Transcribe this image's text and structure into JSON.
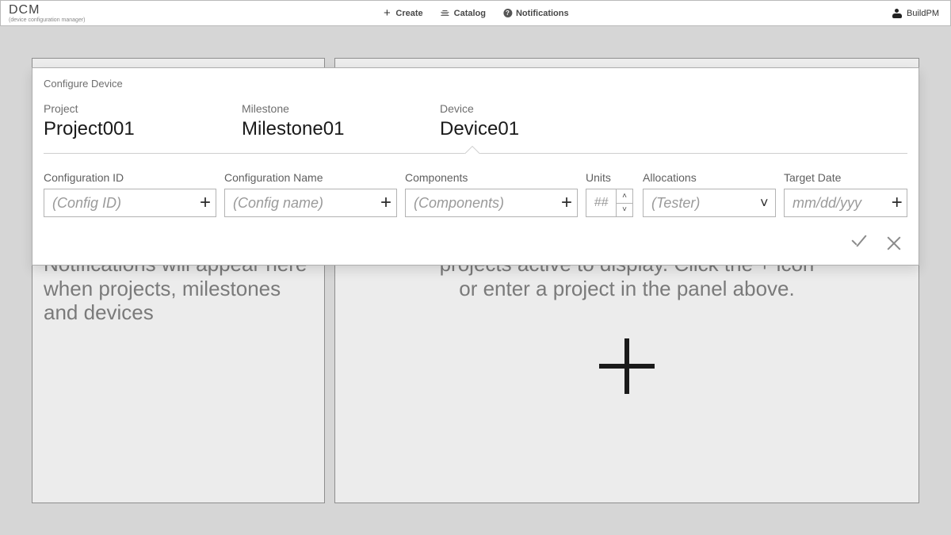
{
  "brand": {
    "title": "DCM",
    "subtitle": "(device configuration manager)"
  },
  "nav": {
    "create": "Create",
    "catalog": "Catalog",
    "notifications": "Notifications",
    "user": "BuildPM"
  },
  "panels": {
    "left_text": "Notifications will appear here when projects, milestones and devices",
    "right_text": "projects active to display. Click the + icon or enter a project in the panel above."
  },
  "modal": {
    "title": "Configure Device",
    "crumbs": {
      "project_label": "Project",
      "project_value": "Project001",
      "milestone_label": "Milestone",
      "milestone_value": "Milestone01",
      "device_label": "Device",
      "device_value": "Device01"
    },
    "fields": {
      "config_id": {
        "label": "Configuration ID",
        "placeholder": "(Config ID)"
      },
      "config_name": {
        "label": "Configuration Name",
        "placeholder": "(Config name)"
      },
      "components": {
        "label": "Components",
        "placeholder": "(Components)"
      },
      "units": {
        "label": "Units",
        "placeholder": "##"
      },
      "allocations": {
        "label": "Allocations",
        "placeholder": "(Tester)"
      },
      "target_date": {
        "label": "Target Date",
        "placeholder": "mm/dd/yyy"
      }
    }
  }
}
